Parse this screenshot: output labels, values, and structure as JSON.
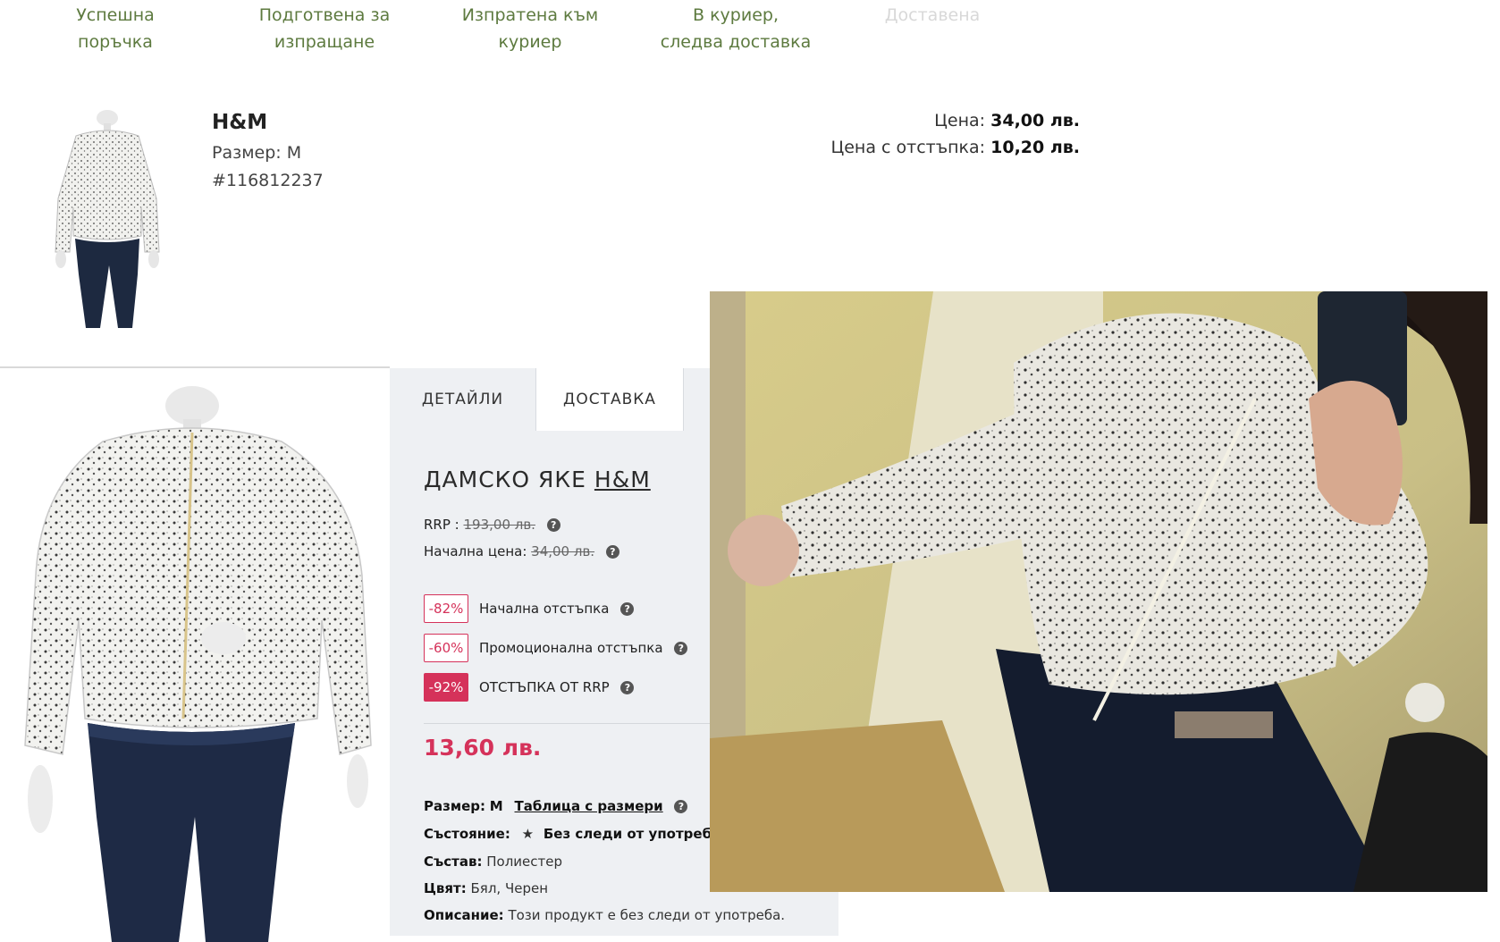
{
  "order_status": {
    "steps": [
      {
        "label": "Успешна поръчка",
        "active": true
      },
      {
        "label": "Подготвена за изпращане",
        "active": true
      },
      {
        "label": "Изпратена към куриер",
        "active": true
      },
      {
        "label": "В куриер, следва доставка",
        "active": true
      },
      {
        "label": "Доставена",
        "active": false
      }
    ]
  },
  "order_item": {
    "brand": "H&M",
    "size": "Размер: M",
    "product_id": "#116812237",
    "price_label": "Цена:",
    "price_value": "34,00 лв.",
    "discount_price_label": "Цена с отстъпка:",
    "discount_price_value": "10,20 лв."
  },
  "product": {
    "tabs": [
      "ДЕТАЙЛИ",
      "ДОСТАВКА"
    ],
    "title_prefix": "ДАМСКО ЯКЕ",
    "title_brand": "H&M",
    "rrp_label": "RRP :",
    "rrp_value": "193,00 лв.",
    "initial_price_label": "Начална цена:",
    "initial_price_value": "34,00 лв.",
    "help_glyph": "?",
    "discounts": [
      {
        "badge": "-82%",
        "label": "Начална отстъпка"
      },
      {
        "badge": "-60%",
        "label": "Промоционална отстъпка"
      },
      {
        "badge": "-92%",
        "label": "ОТСТЪПКА ОТ RRP"
      }
    ],
    "final_price": "13,60 лв.",
    "size_label": "Размер:",
    "size_value": "M",
    "size_table_link": "Таблица с размери",
    "condition_label": "Състояние:",
    "condition_value": "Без следи от употреба",
    "composition_label": "Състав:",
    "composition_value": "Полиестер",
    "color_label": "Цвят:",
    "color_value": "Бял, Черен",
    "description_label": "Описание:",
    "description_value": "Този продукт е без следи от употреба."
  },
  "colors": {
    "status_active": "#5d7a3f",
    "status_inactive": "#d8d8d8",
    "accent": "#d5325a",
    "panel_bg": "#eef0f3"
  }
}
